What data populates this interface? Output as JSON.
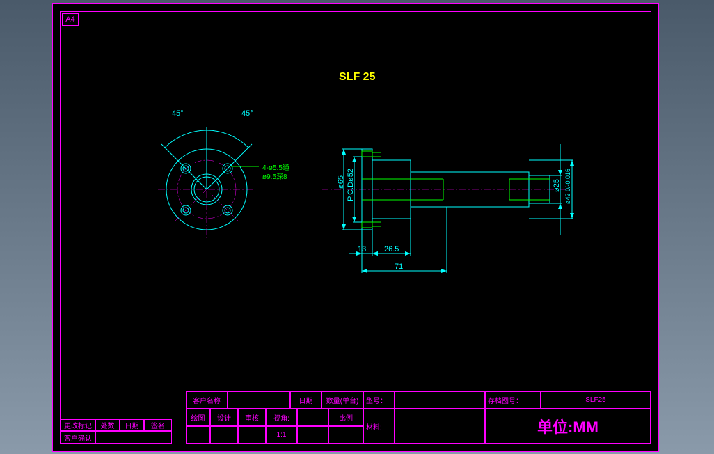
{
  "sheet_label": "A4",
  "part_title": "SLF 25",
  "front_view": {
    "angle_left": "45°",
    "angle_right": "45°",
    "hole_callout_1": "4-ø5.5通",
    "hole_callout_2": "ø9.5深8"
  },
  "side_view": {
    "dia_65": "ø65",
    "pcd_52": "P.C.Dø52",
    "dia_25": "ø25",
    "dia_42": "ø42 0/-0.016",
    "len_13": "13",
    "len_26_5": "26.5",
    "len_71": "71"
  },
  "title_block": {
    "row0": {
      "customer_label": "客户名称",
      "date_label": "日期",
      "qty_label": "数量(单台)",
      "model_label": "型号：",
      "archive_label": "存档图号：",
      "archive_value": "SLF25"
    },
    "row1": {
      "draw_label": "绘图",
      "design_label": "设计",
      "review_label": "审核",
      "view_label": "视角:",
      "scale_label": "比例",
      "material_label": "材料:"
    },
    "row2": {
      "scale_value": "1:1",
      "units_text": "单位:MM"
    },
    "left_block": {
      "change_mark": "更改标记",
      "place_count": "处数",
      "date": "日期",
      "sign": "签名",
      "customer_confirm": "客户确认"
    }
  }
}
